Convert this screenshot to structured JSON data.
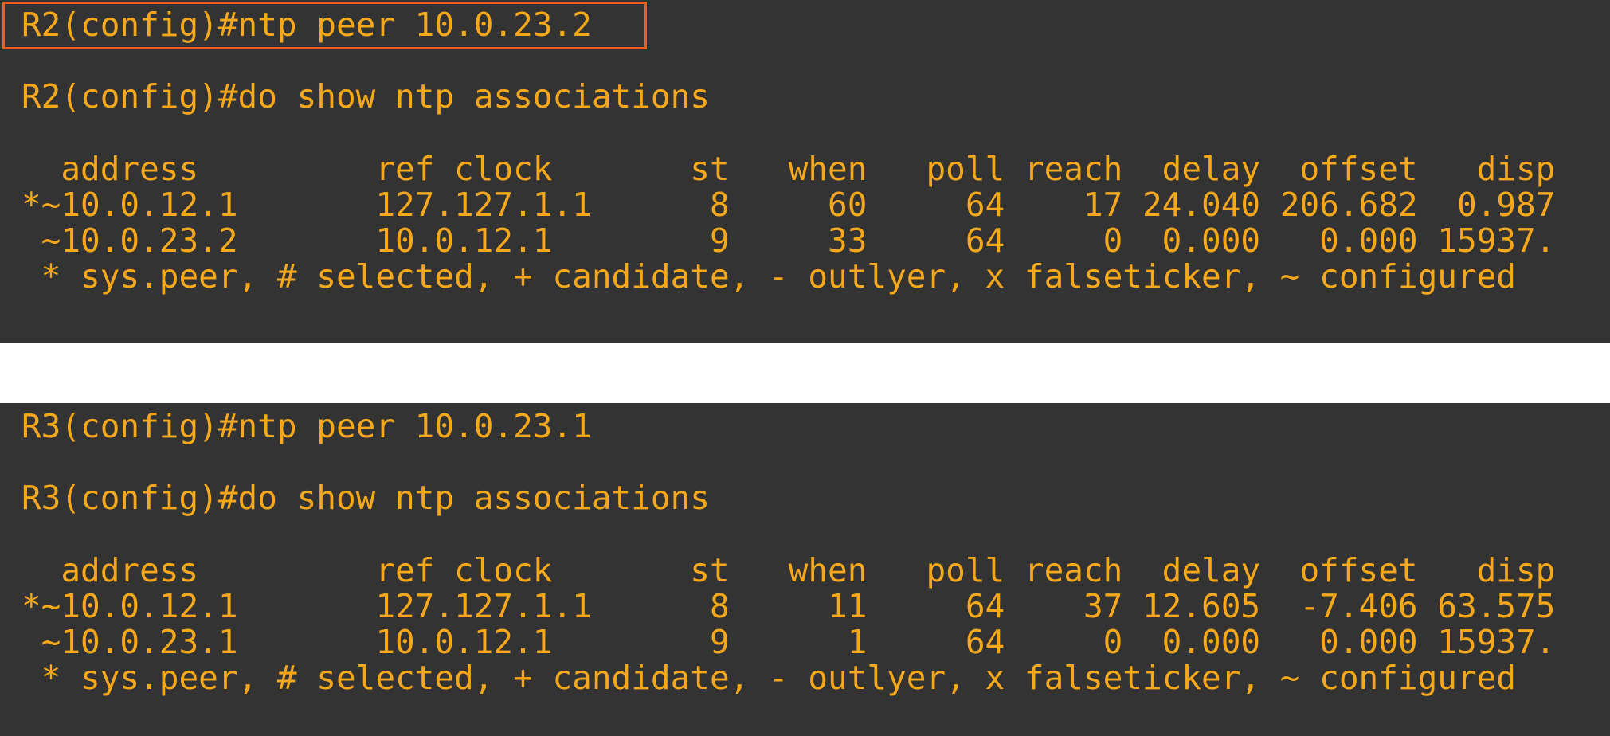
{
  "panels": [
    {
      "name": "R2",
      "command": "R2(config)#ntp peer 10.0.23.2",
      "show_command": "R2(config)#do show ntp associations",
      "header": "  address         ref clock       st   when   poll reach  delay  offset   disp",
      "rows": [
        "*~10.0.12.1       127.127.1.1      8     60     64    17 24.040 206.682  0.987",
        " ~10.0.23.2       10.0.12.1        9     33     64     0  0.000   0.000 15937."
      ],
      "legend": " * sys.peer, # selected, + candidate, - outlyer, x falseticker, ~ configured"
    },
    {
      "name": "R3",
      "command": "R3(config)#ntp peer 10.0.23.1",
      "show_command": "R3(config)#do show ntp associations",
      "header": "  address         ref clock       st   when   poll reach  delay  offset   disp",
      "rows": [
        "*~10.0.12.1       127.127.1.1      8     11     64    37 12.605  -7.406 63.575",
        " ~10.0.23.1       10.0.12.1        9      1     64     0  0.000   0.000 15937."
      ],
      "legend": " * sys.peer, # selected, + candidate, - outlyer, x falseticker, ~ configured"
    }
  ],
  "colors": {
    "terminal_bg": "#333333",
    "terminal_text": "#f5a81c",
    "highlight_border": "#f15a22",
    "page_bg": "#ffffff"
  }
}
